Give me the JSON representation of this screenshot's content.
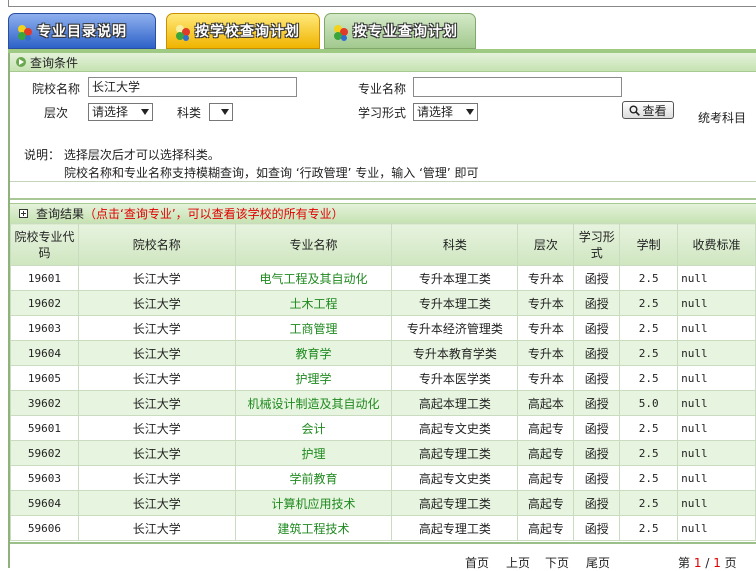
{
  "tabs": [
    {
      "label": "专业目录说明"
    },
    {
      "label": "按学校查询计划"
    },
    {
      "label": "按专业查询计划"
    }
  ],
  "query": {
    "title": "查询条件",
    "school_label": "院校名称",
    "school_value": "长江大学",
    "major_label": "专业名称",
    "major_value": "",
    "level_label": "层次",
    "level_value": "请选择",
    "subject_label": "科类",
    "subject_value": "",
    "mode_label": "学习形式",
    "mode_value": "请选择",
    "search_label": "查看",
    "exam_label": "统考科目"
  },
  "notes": {
    "line1": "说明：  选择层次后才可以选择科类。",
    "line2": "院校名称和专业名称支持模糊查询，如查询 ‘行政管理’ 专业，输入 ‘管理’ 即可"
  },
  "results": {
    "title": "查询结果",
    "hint": "（点击‘查询专业’，可以查看该学校的所有专业）",
    "headers": [
      "院校专业代码",
      "院校名称",
      "专业名称",
      "科类",
      "层次",
      "学习形式",
      "学制",
      "收费标准"
    ],
    "rows": [
      [
        "19601",
        "长江大学",
        "电气工程及其自动化",
        "专升本理工类",
        "专升本",
        "函授",
        "2.5",
        "null"
      ],
      [
        "19602",
        "长江大学",
        "土木工程",
        "专升本理工类",
        "专升本",
        "函授",
        "2.5",
        "null"
      ],
      [
        "19603",
        "长江大学",
        "工商管理",
        "专升本经济管理类",
        "专升本",
        "函授",
        "2.5",
        "null"
      ],
      [
        "19604",
        "长江大学",
        "教育学",
        "专升本教育学类",
        "专升本",
        "函授",
        "2.5",
        "null"
      ],
      [
        "19605",
        "长江大学",
        "护理学",
        "专升本医学类",
        "专升本",
        "函授",
        "2.5",
        "null"
      ],
      [
        "39602",
        "长江大学",
        "机械设计制造及其自动化",
        "高起本理工类",
        "高起本",
        "函授",
        "5.0",
        "null"
      ],
      [
        "59601",
        "长江大学",
        "会计",
        "高起专文史类",
        "高起专",
        "函授",
        "2.5",
        "null"
      ],
      [
        "59602",
        "长江大学",
        "护理",
        "高起专理工类",
        "高起专",
        "函授",
        "2.5",
        "null"
      ],
      [
        "59603",
        "长江大学",
        "学前教育",
        "高起专文史类",
        "高起专",
        "函授",
        "2.5",
        "null"
      ],
      [
        "59604",
        "长江大学",
        "计算机应用技术",
        "高起专理工类",
        "高起专",
        "函授",
        "2.5",
        "null"
      ],
      [
        "59606",
        "长江大学",
        "建筑工程技术",
        "高起专理工类",
        "高起专",
        "函授",
        "2.5",
        "null"
      ]
    ]
  },
  "pager": {
    "first": "首页",
    "prev": "上页",
    "next": "下页",
    "last": "尾页",
    "page_prefix": "第",
    "current": "1",
    "sep": "/",
    "total": "1",
    "page_suffix": "页"
  }
}
